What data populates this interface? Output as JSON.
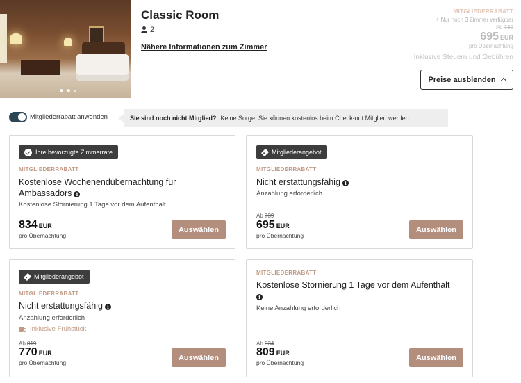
{
  "room": {
    "title": "Classic Room",
    "guests": "2",
    "more_info_link": "Nähere Informationen zum Zimmer",
    "photo_alt": "Classic Room photo"
  },
  "price_header": {
    "member_tag": "MITGLIEDERRABATT",
    "availability": "Nur noch 3 Zimmer verfügbar",
    "from_label": "Ab",
    "from_price": "739",
    "amount": "695",
    "currency": "EUR",
    "per_night": "pro Übernachtung",
    "tax_note": "Inklusive Steuern und Gebühren",
    "hide_button": "Preise ausblenden"
  },
  "member_toggle": {
    "label": "Mitgliederrabatt anwenden",
    "enabled": true,
    "hint_bold": "Sie sind noch nicht Mitglied?",
    "hint_text": "Keine Sorge, Sie können kostenlos beim Check-out Mitglied werden."
  },
  "rates": [
    {
      "badge": "Ihre bevorzugte Zimmerrate",
      "badge_icon": "check-circle-icon",
      "tag": "MITGLIEDERRABATT",
      "title": "Kostenlose Wochenendübernachtung für Ambassadors",
      "subtitle": "Kostenlose Stornierung 1 Tage vor dem Aufenthalt",
      "amount": "834",
      "currency": "EUR",
      "per_night": "pro Übernachtung",
      "button": "Auswählen"
    },
    {
      "badge": "Mitgliederangebot",
      "badge_icon": "tag-icon",
      "tag": "MITGLIEDERRABATT",
      "title": "Nicht erstattungsfähig",
      "subtitle": "Anzahlung erforderlich",
      "from_label": "Ab",
      "from_price": "739",
      "amount": "695",
      "currency": "EUR",
      "per_night": "pro Übernachtung",
      "button": "Auswählen"
    },
    {
      "badge": "Mitgliederangebot",
      "badge_icon": "tag-icon",
      "tag": "MITGLIEDERRABATT",
      "title": "Nicht erstattungsfähig",
      "subtitle": "Anzahlung erforderlich",
      "extra": "Inklusive Frühstück",
      "from_label": "Ab",
      "from_price": "819",
      "amount": "770",
      "currency": "EUR",
      "per_night": "pro Übernachtung",
      "button": "Auswählen"
    },
    {
      "tag": "MITGLIEDERRABATT",
      "title": "Kostenlose Stornierung 1 Tage vor dem Aufenthalt",
      "subtitle": "Keine Anzahlung erforderlich",
      "from_label": "Ab",
      "from_price": "834",
      "amount": "809",
      "currency": "EUR",
      "per_night": "pro Übernachtung",
      "button": "Auswählen"
    }
  ],
  "colors": {
    "accent_button": "#b38e7c",
    "member_tag": "#c19a85",
    "toggle": "#2c4656",
    "badge_bg": "#3d3d3d"
  }
}
